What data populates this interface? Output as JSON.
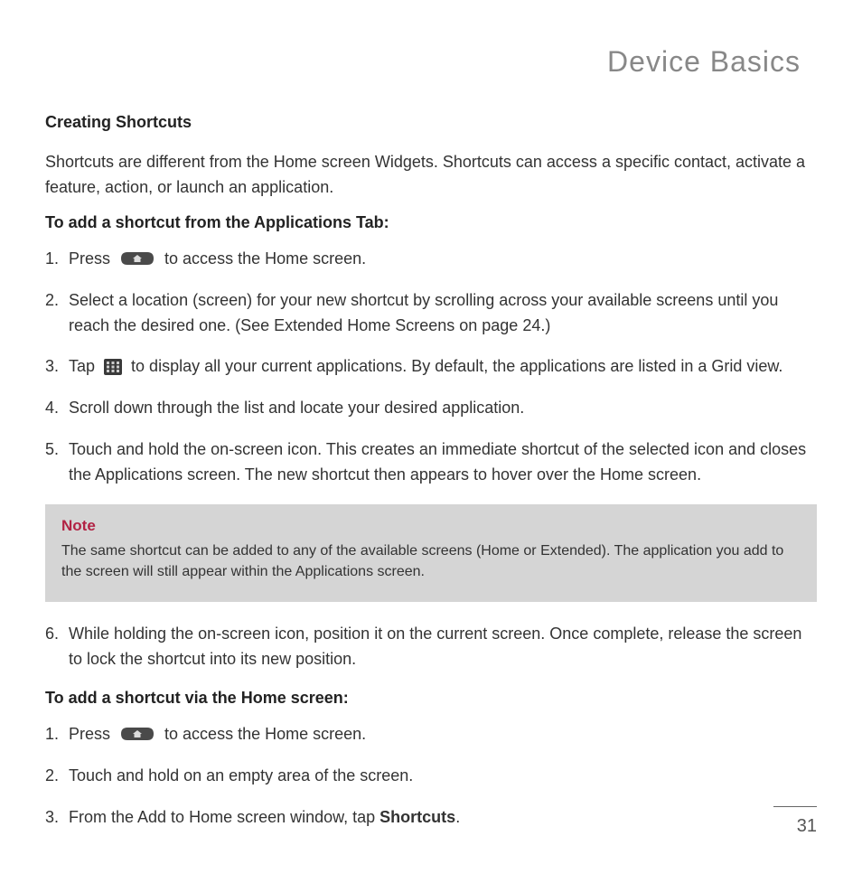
{
  "header": {
    "title": "Device Basics"
  },
  "sections": {
    "heading": "Creating Shortcuts",
    "intro": "Shortcuts are different from the Home screen Widgets. Shortcuts can access a specific contact, activate a feature, action, or launch an application.",
    "sub1": "To add a shortcut from the Applications Tab:",
    "steps1": {
      "s1a": "Press ",
      "s1b": " to access the Home screen.",
      "s2": "Select a location (screen) for your new shortcut by scrolling across your available screens until you reach the desired one. (See Extended Home Screens on page 24.)",
      "s3a": "Tap ",
      "s3b": " to display all your current applications. By default, the applications are listed in a Grid view.",
      "s4": "Scroll down through the list and locate your desired application.",
      "s5": "Touch and hold the on-screen icon. This creates an immediate shortcut of the selected icon and closes the Applications screen. The new shortcut then appears to hover over the Home screen.",
      "s6": "While holding the on-screen icon, position it on the current screen. Once complete, release the screen to lock the shortcut into its new position."
    },
    "note": {
      "label": "Note",
      "text": "The same shortcut can be added to any of the available screens (Home or Extended). The application you add to the screen will still appear within the Applications screen."
    },
    "sub2": "To add a shortcut via the Home screen:",
    "steps2": {
      "s1a": "Press ",
      "s1b": " to access the Home screen.",
      "s2": "Touch and hold on an empty area of the screen.",
      "s3a": "From the Add to Home screen window, tap ",
      "s3b": "Shortcuts",
      "s3c": "."
    }
  },
  "page_number": "31"
}
